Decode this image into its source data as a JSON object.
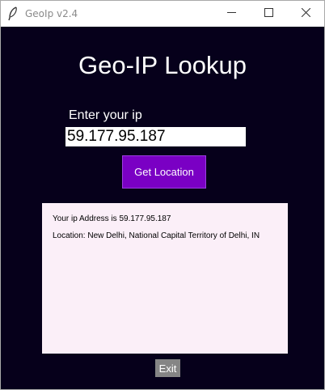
{
  "window": {
    "title": "GeoIp v2.4",
    "icon": "feather-icon"
  },
  "titlebar_controls": {
    "minimize_icon": "minimize-icon",
    "maximize_icon": "maximize-icon",
    "close_icon": "close-icon"
  },
  "main": {
    "heading": "Geo-IP Lookup",
    "ip_label": "Enter your ip",
    "ip_value": "59.177.95.187",
    "button_label": "Get Location",
    "result": {
      "line1": "Your ip Address is 59.177.95.187",
      "line2": "Location: New Delhi, National Capital Territory of Delhi, IN"
    },
    "exit_label": "Exit"
  },
  "colors": {
    "background": "#06001b",
    "accent_button": "#7a00c4",
    "result_box": "#fbeff8",
    "exit_button": "#858585"
  }
}
